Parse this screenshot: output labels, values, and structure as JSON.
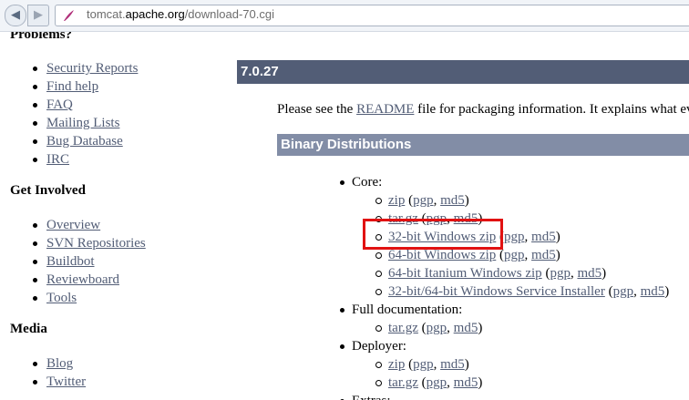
{
  "browser": {
    "url_prefix": "tomcat.",
    "url_domain": "apache.org",
    "url_path": "/download-70.cgi"
  },
  "sidebar": {
    "sections": [
      {
        "heading": "Problems?",
        "items": [
          "Security Reports",
          "Find help",
          "FAQ",
          "Mailing Lists",
          "Bug Database",
          "IRC"
        ]
      },
      {
        "heading": "Get Involved",
        "items": [
          "Overview",
          "SVN Repositories",
          "Buildbot",
          "Reviewboard",
          "Tools"
        ]
      },
      {
        "heading": "Media",
        "items": [
          "Blog",
          "Twitter"
        ]
      }
    ]
  },
  "main": {
    "version_title": "7.0.27",
    "intro": {
      "before": "Please see the ",
      "link": "README",
      "after": " file for packaging information. It explains what ev"
    },
    "binary_title": "Binary Distributions",
    "categories": [
      {
        "label": "Core:",
        "items": [
          {
            "name": "zip",
            "sigs": [
              "pgp",
              "md5"
            ]
          },
          {
            "name": "tar.gz",
            "sigs": [
              "pgp",
              "md5"
            ]
          },
          {
            "name": "32-bit Windows zip",
            "sigs": [
              "pgp",
              "md5"
            ]
          },
          {
            "name": "64-bit Windows zip",
            "sigs": [
              "pgp",
              "md5"
            ]
          },
          {
            "name": "64-bit Itanium Windows zip",
            "sigs": [
              "pgp",
              "md5"
            ]
          },
          {
            "name": "32-bit/64-bit Windows Service Installer",
            "sigs": [
              "pgp",
              "md5"
            ]
          }
        ]
      },
      {
        "label": "Full documentation:",
        "items": [
          {
            "name": "tar.gz",
            "sigs": [
              "pgp",
              "md5"
            ]
          }
        ]
      },
      {
        "label": "Deployer:",
        "items": [
          {
            "name": "zip",
            "sigs": [
              "pgp",
              "md5"
            ]
          },
          {
            "name": "tar.gz",
            "sigs": [
              "pgp",
              "md5"
            ]
          }
        ]
      },
      {
        "label": "Extras:",
        "items": []
      }
    ]
  },
  "colors": {
    "link": "#525D76",
    "version_bar": "#525D76",
    "section_bar": "#828DA6",
    "highlight": "#E11212"
  }
}
